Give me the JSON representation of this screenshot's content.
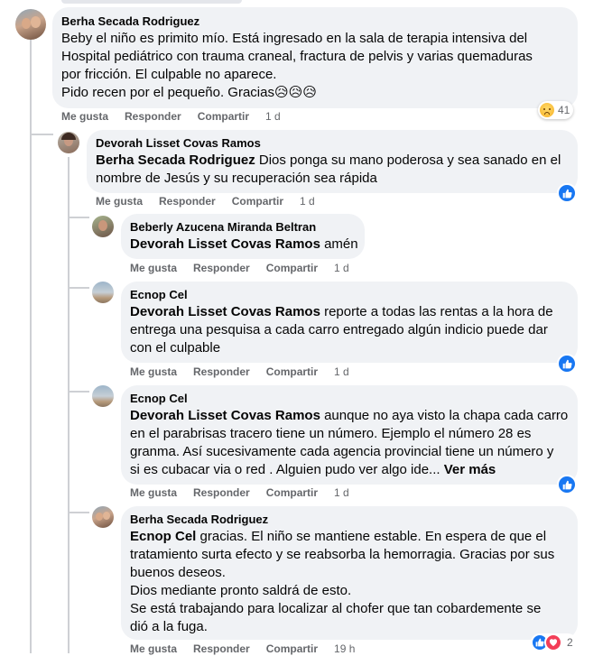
{
  "top_comment": {
    "author": "Berha Secada Rodriguez",
    "lines": [
      "Beby el niño es primito mío. Está ingresado en la sala de terapia intensiva del",
      "Hospital pediátrico con trauma craneal, fractura de pelvis y varias quemaduras",
      "por fricción. El culpable no aparece.",
      "Pido recen por el pequeño. Gracias😥😥😥"
    ],
    "reaction_count": "41",
    "reaction_icon": "sad-face-icon",
    "time": "1 d"
  },
  "actions": {
    "like": "Me gusta",
    "reply": "Responder",
    "share": "Compartir"
  },
  "replies": [
    {
      "author": "Devorah Lisset Covas Ramos",
      "mention": "Berha Secada Rodriguez",
      "line1_rest": " Dios ponga su mano poderosa y sea sanado en el",
      "line2": "nombre de Jesús y su recuperación sea rápida",
      "time": "1 d"
    },
    {
      "author": "Beberly Azucena Miranda Beltran",
      "mention": "Devorah Lisset Covas Ramos",
      "rest": " amén",
      "time": "1 d"
    },
    {
      "author": "Ecnop Cel",
      "mention": "Devorah Lisset Covas Ramos",
      "line1_rest": " reporte a todas las rentas a la hora de",
      "line2": "entrega una pesquisa a cada carro entregado algún indicio puede dar",
      "line3": "con el culpable",
      "time": "1 d"
    },
    {
      "author": "Ecnop Cel",
      "mention": "Devorah Lisset Covas Ramos",
      "line1_rest": " aunque no aya visto la chapa cada carro",
      "line2": "en el parabrisas tracero tiene un número. Ejemplo el número 28 es",
      "line3": "granma. Así sucesivamente cada agencia provincial tiene un número y",
      "line4": "si es cubacar via o red . Alguien pudo ver algo ide...",
      "see_more": "Ver más",
      "time": "1 d"
    },
    {
      "author": "Berha Secada Rodriguez",
      "mention": "Ecnop Cel",
      "line1_rest": " gracias. El niño se mantiene estable. En espera de que el",
      "line2": "tratamiento surta efecto y se reabsorba la hemorragia. Gracias por sus",
      "line3": "buenos deseos.",
      "line4": "Dios mediante pronto saldrá de esto.",
      "line5": "Se está trabajando para localizar al chofer que tan cobardemente se",
      "line6": "dió a la fuga.",
      "reaction_count": "2",
      "time": "19 h"
    }
  ],
  "colors": {
    "bubble": "#f0f2f5",
    "like_blue": "#1877f2",
    "meta_gray": "#65676b",
    "heart": "#f33e58"
  }
}
